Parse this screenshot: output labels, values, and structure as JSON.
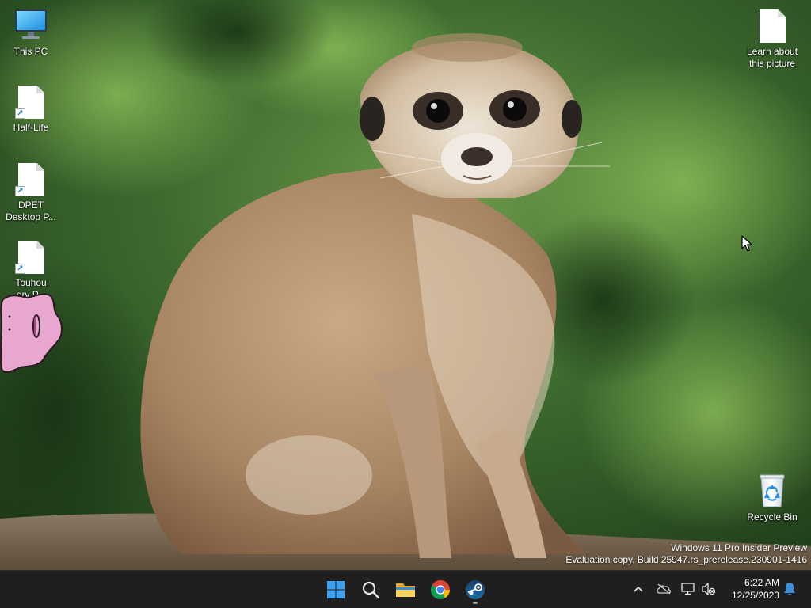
{
  "desktop": {
    "icons_left": [
      {
        "label": "This PC",
        "icon": "monitor-icon"
      },
      {
        "label": "Half-Life",
        "icon": "file-shortcut-icon"
      },
      {
        "label": "DPET\nDesktop P...",
        "icon": "file-shortcut-icon"
      },
      {
        "label": "Touhou\nery P...",
        "icon": "file-shortcut-icon"
      }
    ],
    "icons_right": [
      {
        "label": "Learn about\nthis picture",
        "icon": "file-icon"
      },
      {
        "label": "Recycle Bin",
        "icon": "recycle-bin-icon"
      }
    ],
    "pet": "ditto-desktop-pet",
    "wallpaper": "meerkat-photo"
  },
  "watermark": {
    "line1": "Windows 11 Pro Insider Preview",
    "line2": "Evaluation copy. Build 25947.rs_prerelease.230901-1416"
  },
  "taskbar": {
    "apps": [
      {
        "name": "Start",
        "icon": "windows-start-icon"
      },
      {
        "name": "Search",
        "icon": "search-icon"
      },
      {
        "name": "File Explorer",
        "icon": "folder-icon"
      },
      {
        "name": "Google Chrome",
        "icon": "chrome-icon"
      },
      {
        "name": "Steam",
        "icon": "steam-icon",
        "running": true
      }
    ],
    "tray": [
      "chevron-up-icon",
      "onedrive-offline-icon",
      "network-icon",
      "volume-muted-icon"
    ],
    "time": "6:22 AM",
    "date": "12/25/2023",
    "notification_icon": "bell-icon"
  },
  "colors": {
    "taskbar_bg": "#1f1f1f",
    "start_blue": "#3aa0f2",
    "accent": "#3b8fd6"
  }
}
